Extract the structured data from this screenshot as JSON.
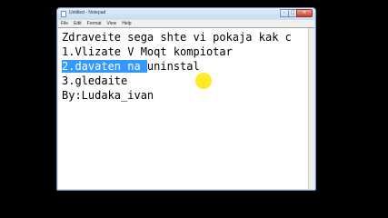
{
  "window": {
    "title": "Untitled - Notepad",
    "minimize": "–",
    "maximize": "□",
    "close": "✕"
  },
  "menu": [
    "File",
    "Edit",
    "Format",
    "View",
    "Help"
  ],
  "editor": {
    "lines": [
      {
        "text": "Zdraveite sega shte vi pokaja kak c",
        "selected": ""
      },
      {
        "text": "1.Vlizate V Moqt kompiotar",
        "selected": ""
      },
      {
        "text": "uninstal",
        "selected": "2.davaten na "
      },
      {
        "text": "3.gledaite",
        "selected": ""
      },
      {
        "text": "By:Ludaka_ivan",
        "selected": ""
      }
    ]
  },
  "colors": {
    "selection": "#3399ff",
    "cursor_highlight": "#ffe800",
    "background": "#000000"
  }
}
